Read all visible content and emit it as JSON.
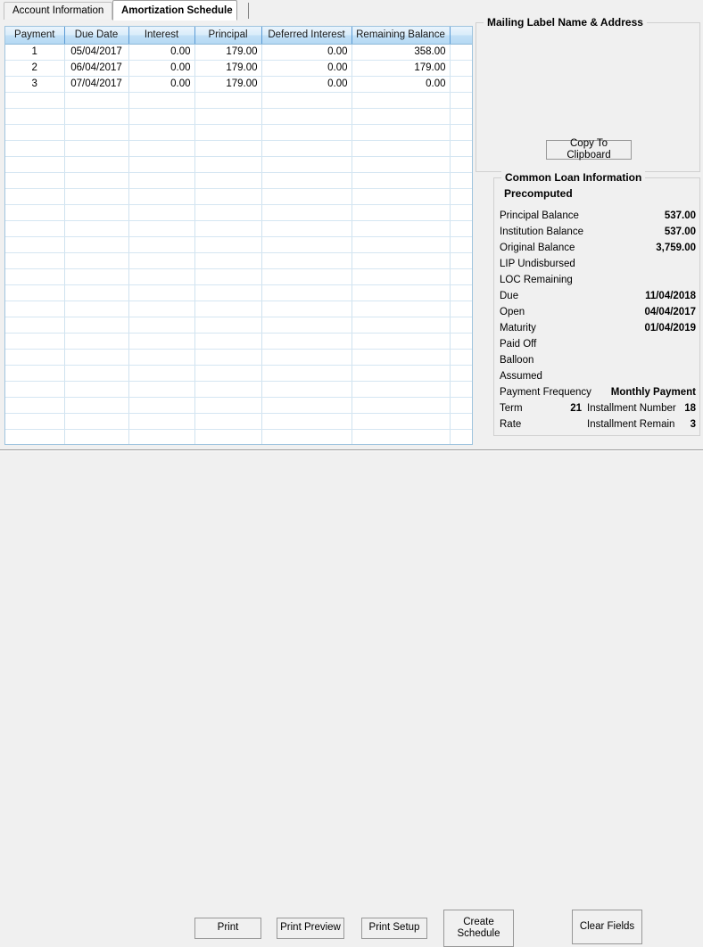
{
  "tabs": [
    {
      "label": "Account Information",
      "active": false
    },
    {
      "label": "Amortization Schedule",
      "active": true
    }
  ],
  "grid": {
    "columns": [
      "Payment",
      "Due Date",
      "Interest",
      "Principal",
      "Deferred Interest",
      "Remaining Balance",
      ""
    ],
    "rows": [
      {
        "payment": "1",
        "due_date": "05/04/2017",
        "interest": "0.00",
        "principal": "179.00",
        "deferred_interest": "0.00",
        "remaining_balance": "358.00",
        "extra": ""
      },
      {
        "payment": "2",
        "due_date": "06/04/2017",
        "interest": "0.00",
        "principal": "179.00",
        "deferred_interest": "0.00",
        "remaining_balance": "179.00",
        "extra": ""
      },
      {
        "payment": "3",
        "due_date": "07/04/2017",
        "interest": "0.00",
        "principal": "179.00",
        "deferred_interest": "0.00",
        "remaining_balance": "0.00",
        "extra": ""
      }
    ],
    "empty_row_count": 22
  },
  "mailing": {
    "title": "Mailing Label Name & Address",
    "body": "",
    "copy_button": "Copy To Clipboard"
  },
  "loan": {
    "title": "Common Loan Information",
    "subtitle": "Precomputed",
    "fields": [
      {
        "label": "Principal Balance",
        "value": "537.00"
      },
      {
        "label": "Institution Balance",
        "value": "537.00"
      },
      {
        "label": "Original Balance",
        "value": "3,759.00"
      },
      {
        "label": "LIP Undisbursed",
        "value": ""
      },
      {
        "label": "LOC Remaining",
        "value": ""
      },
      {
        "label": "Due",
        "value": "11/04/2018"
      },
      {
        "label": "Open",
        "value": "04/04/2017"
      },
      {
        "label": "Maturity",
        "value": "01/04/2019"
      },
      {
        "label": "Paid Off",
        "value": ""
      },
      {
        "label": "Balloon",
        "value": ""
      },
      {
        "label": "Assumed",
        "value": ""
      },
      {
        "label": "Payment Frequency",
        "value": "Monthly Payment"
      }
    ],
    "split_rows": [
      {
        "label": "Term",
        "value": "21",
        "label2": "Installment Number",
        "value2": "18"
      },
      {
        "label": "Rate",
        "value": "",
        "label2": "Installment Remain",
        "value2": "3"
      }
    ]
  },
  "buttons": {
    "print": "Print",
    "print_preview": "Print Preview",
    "print_setup": "Print Setup",
    "create_schedule": "Create\nSchedule",
    "clear_fields": "Clear Fields"
  }
}
